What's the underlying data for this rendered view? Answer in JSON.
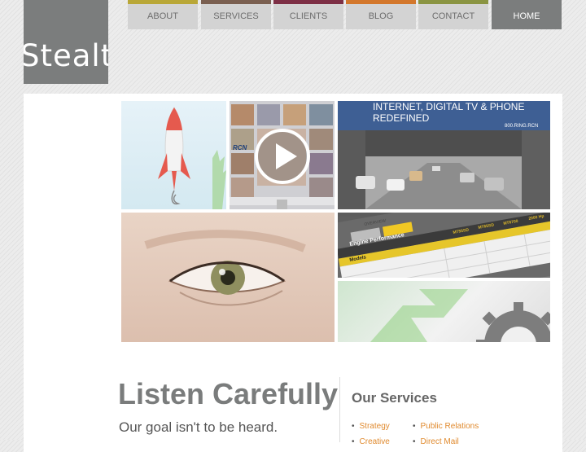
{
  "logo": {
    "text": "Stealth"
  },
  "nav": [
    {
      "label": "ABOUT",
      "color": "#b9a737"
    },
    {
      "label": "SERVICES",
      "color": "#7a5f50"
    },
    {
      "label": "CLIENTS",
      "color": "#7d2f45"
    },
    {
      "label": "BLOG",
      "color": "#d3772c"
    },
    {
      "label": "CONTACT",
      "color": "#8a9442"
    },
    {
      "label": "HOME"
    }
  ],
  "hero": {
    "tv_logo": "RCN",
    "billboard": {
      "line1": "INTERNET, DIGITAL TV & PHONE",
      "line2": "REDEFINED",
      "phone": "800.RING.RCN"
    },
    "table": {
      "tab": "OVERVIEW",
      "heading": "Engine Performance",
      "row_label": "Models",
      "columns": [
        "MT55SD",
        "MT65SD",
        "MT6700",
        "2000 Hp"
      ]
    }
  },
  "main": {
    "headline": "Listen Carefully",
    "tagline": "Our goal isn't to be heard."
  },
  "services": {
    "title": "Our Services",
    "items": [
      "Strategy",
      "Public Relations",
      "Creative",
      "Direct Mail"
    ]
  }
}
